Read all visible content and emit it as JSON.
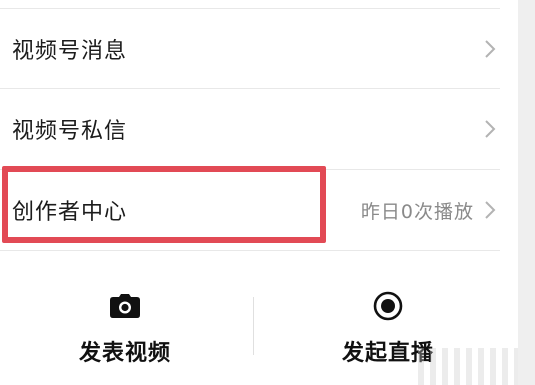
{
  "menu": {
    "items": [
      {
        "label": "视频号消息",
        "value": ""
      },
      {
        "label": "视频号私信",
        "value": ""
      },
      {
        "label": "创作者中心",
        "value": "昨日0次播放"
      }
    ]
  },
  "actions": {
    "post_video_label": "发表视频",
    "post_video_icon": "camera-icon",
    "start_live_label": "发起直播",
    "start_live_icon": "record-icon"
  },
  "colors": {
    "highlight": "#e24a55",
    "chevron": "#b3b3b3",
    "secondary_text": "#8a8a8a"
  }
}
